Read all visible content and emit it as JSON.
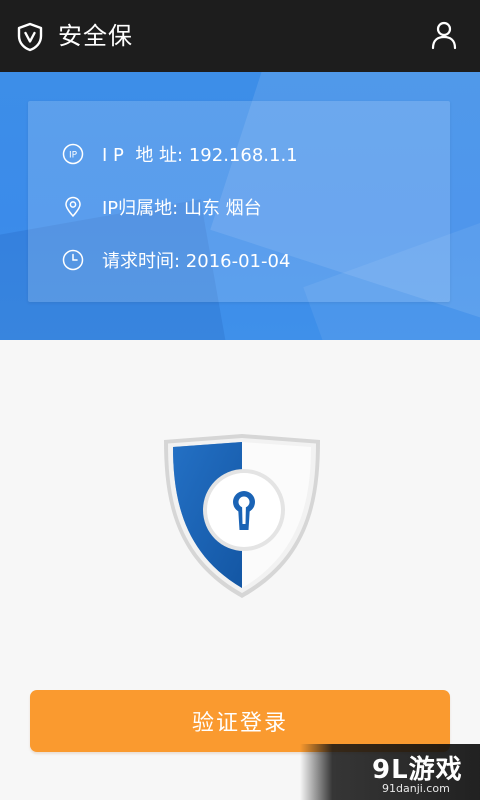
{
  "app": {
    "title": "安全保",
    "icons": {
      "logo": "shield-v-icon",
      "account": "user-icon"
    }
  },
  "info_card": {
    "rows": [
      {
        "icon": "ip-icon",
        "text": "I P  地 址: 192.168.1.1"
      },
      {
        "icon": "location-pin-icon",
        "text": "IP归属地: 山东 烟台"
      },
      {
        "icon": "clock-icon",
        "text": "请求时间: 2016-01-04"
      }
    ]
  },
  "illustration": {
    "icon": "shield-lock-icon"
  },
  "actions": {
    "login_label": "验证登录"
  },
  "watermark": {
    "main": "9L游戏",
    "sub": "91danji.com"
  },
  "colors": {
    "topbar": "#1d1d1d",
    "hero_blue": "#3d8ee8",
    "button_orange": "#fa9a2f",
    "shield_blue": "#1a63b5"
  }
}
